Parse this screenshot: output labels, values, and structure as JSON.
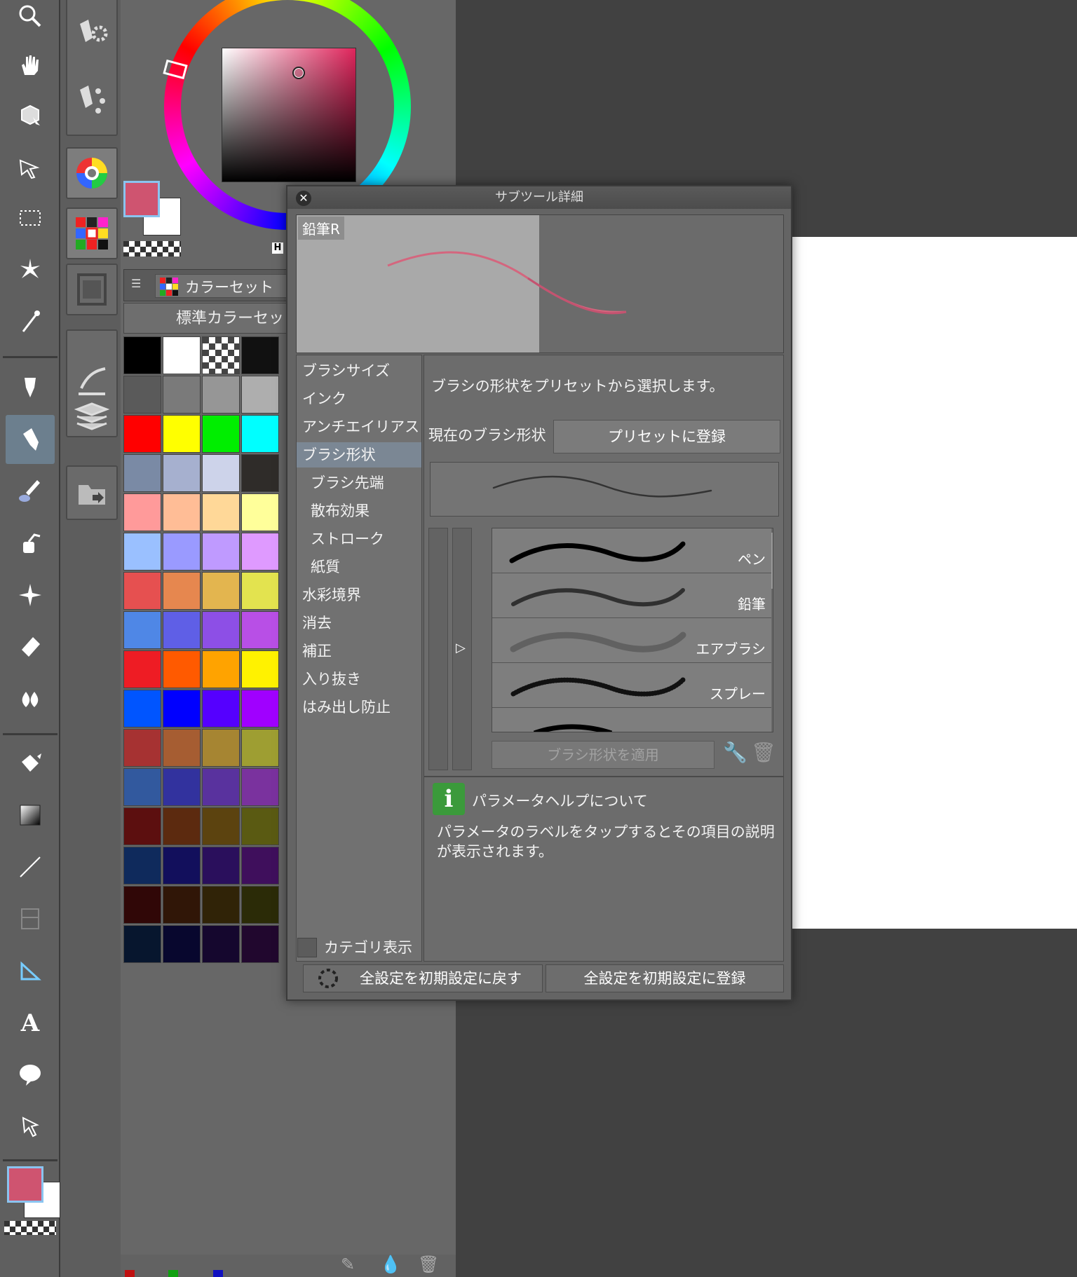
{
  "dialog": {
    "title": "サブツール詳細",
    "close_icon": "close-icon",
    "preview_label": "鉛筆R",
    "categories": [
      {
        "label": "ブラシサイズ",
        "indent": false,
        "selected": false
      },
      {
        "label": "インク",
        "indent": false,
        "selected": false
      },
      {
        "label": "アンチエイリアス",
        "indent": false,
        "selected": false
      },
      {
        "label": "ブラシ形状",
        "indent": false,
        "selected": true
      },
      {
        "label": "ブラシ先端",
        "indent": true,
        "selected": false
      },
      {
        "label": "散布効果",
        "indent": true,
        "selected": false
      },
      {
        "label": "ストローク",
        "indent": true,
        "selected": false
      },
      {
        "label": "紙質",
        "indent": true,
        "selected": false
      },
      {
        "label": "水彩境界",
        "indent": false,
        "selected": false
      },
      {
        "label": "消去",
        "indent": false,
        "selected": false
      },
      {
        "label": "補正",
        "indent": false,
        "selected": false
      },
      {
        "label": "入り抜き",
        "indent": false,
        "selected": false
      },
      {
        "label": "はみ出し防止",
        "indent": false,
        "selected": false
      }
    ],
    "category_display_label": "カテゴリ表示",
    "description": "ブラシの形状をプリセットから選択します。",
    "current_shape_label": "現在のブラシ形状",
    "register_preset_label": "プリセットに登録",
    "shape_presets": [
      "ペン",
      "鉛筆",
      "エアブラシ",
      "スプレー"
    ],
    "apply_label": "ブラシ形状を適用",
    "help_title": "パラメータヘルプについて",
    "help_text": "パラメータのラベルをタップするとその項目の説明が表示されます。",
    "reset_all_label": "全設定を初期設定に戻す",
    "register_all_label": "全設定を初期設定に登録"
  },
  "color_panel": {
    "tab_label": "カラーセット",
    "set_name": "標準カラーセッ",
    "hue_indicator": "H",
    "main_color": "#cf5470",
    "sub_color": "#ffffff"
  },
  "colors": {
    "accent": "#cf5470",
    "selection": "#7b8794",
    "help_green": "#3b9a3b"
  }
}
